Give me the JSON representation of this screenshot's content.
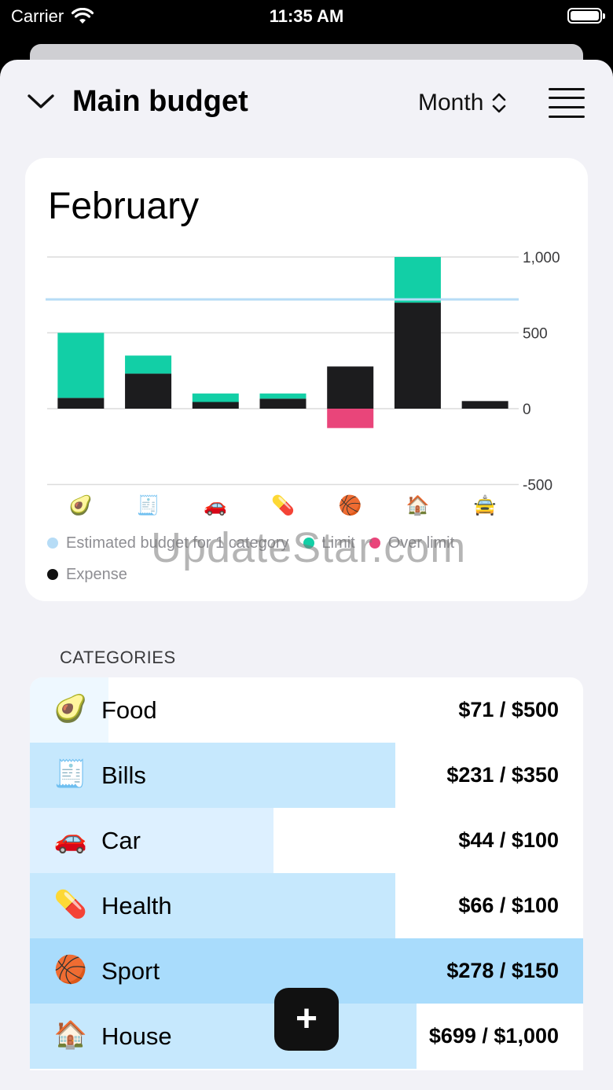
{
  "status_bar": {
    "carrier": "Carrier",
    "time": "11:35 AM"
  },
  "nav": {
    "title": "Main budget",
    "period": "Month"
  },
  "chart_card": {
    "month": "February"
  },
  "chart_data": {
    "type": "bar",
    "stacked": true,
    "categories": [
      "🥑",
      "🧾",
      "🚗",
      "💊",
      "🏀",
      "🏠",
      "🚖"
    ],
    "series": [
      {
        "name": "Expense",
        "color": "#1c1c1e",
        "values": [
          71,
          231,
          44,
          66,
          278,
          699,
          50
        ]
      },
      {
        "name": "Limit",
        "color": "#12cfa6",
        "values": [
          429,
          119,
          56,
          34,
          0,
          301,
          0
        ]
      },
      {
        "name": "Over limit",
        "color": "#e9457a",
        "values": [
          0,
          0,
          0,
          0,
          -128,
          0,
          0
        ]
      }
    ],
    "reference_lines": [
      {
        "name": "Estimated budget for 1 category",
        "value": 720,
        "color": "#b6dcf6"
      }
    ],
    "y_ticks": [
      "1,000",
      "500",
      "0",
      "-500"
    ],
    "ylim": [
      -500,
      1000
    ],
    "grid": true,
    "legend": [
      {
        "label": "Estimated budget for 1 category",
        "color": "#b6dcf6"
      },
      {
        "label": "Limit",
        "color": "#12cfa6"
      },
      {
        "label": "Over limit",
        "color": "#e9457a"
      },
      {
        "label": "Expense",
        "color": "#111111"
      }
    ]
  },
  "watermark": "UpdateStar.com",
  "categories_header": "CATEGORIES",
  "categories": [
    {
      "emoji": "🥑",
      "name": "Food",
      "amount": "$71 / $500",
      "spent_fraction": 0.142,
      "bar_color": "#eef8ff"
    },
    {
      "emoji": "🧾",
      "name": "Bills",
      "amount": "$231 / $350",
      "spent_fraction": 0.66,
      "bar_color": "#c6e8fd"
    },
    {
      "emoji": "🚗",
      "name": "Car",
      "amount": "$44 / $100",
      "spent_fraction": 0.44,
      "bar_color": "#ddf0ff"
    },
    {
      "emoji": "💊",
      "name": "Health",
      "amount": "$66 / $100",
      "spent_fraction": 0.66,
      "bar_color": "#c6e8fd"
    },
    {
      "emoji": "🏀",
      "name": "Sport",
      "amount": "$278 / $150",
      "spent_fraction": 1.0,
      "bar_color": "#a9dcfc"
    },
    {
      "emoji": "🏠",
      "name": "House",
      "amount": "$699 / $1,000",
      "spent_fraction": 0.699,
      "bar_color": "#c6e8fd"
    }
  ],
  "add_button": {
    "label": "+"
  }
}
